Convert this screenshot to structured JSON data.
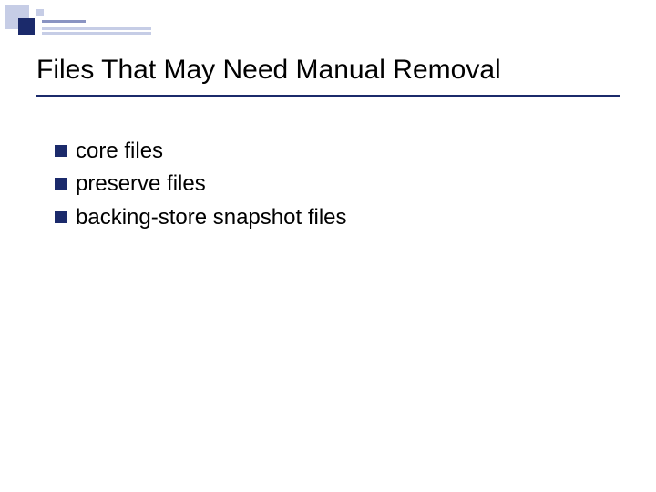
{
  "slide": {
    "title": "Files That May Need Manual Removal",
    "bullets": [
      "core files",
      "preserve files",
      "backing-store snapshot files"
    ]
  },
  "colors": {
    "accent_dark": "#1b2a6b",
    "accent_light": "#c6cde6",
    "accent_mid": "#8a94c2"
  }
}
